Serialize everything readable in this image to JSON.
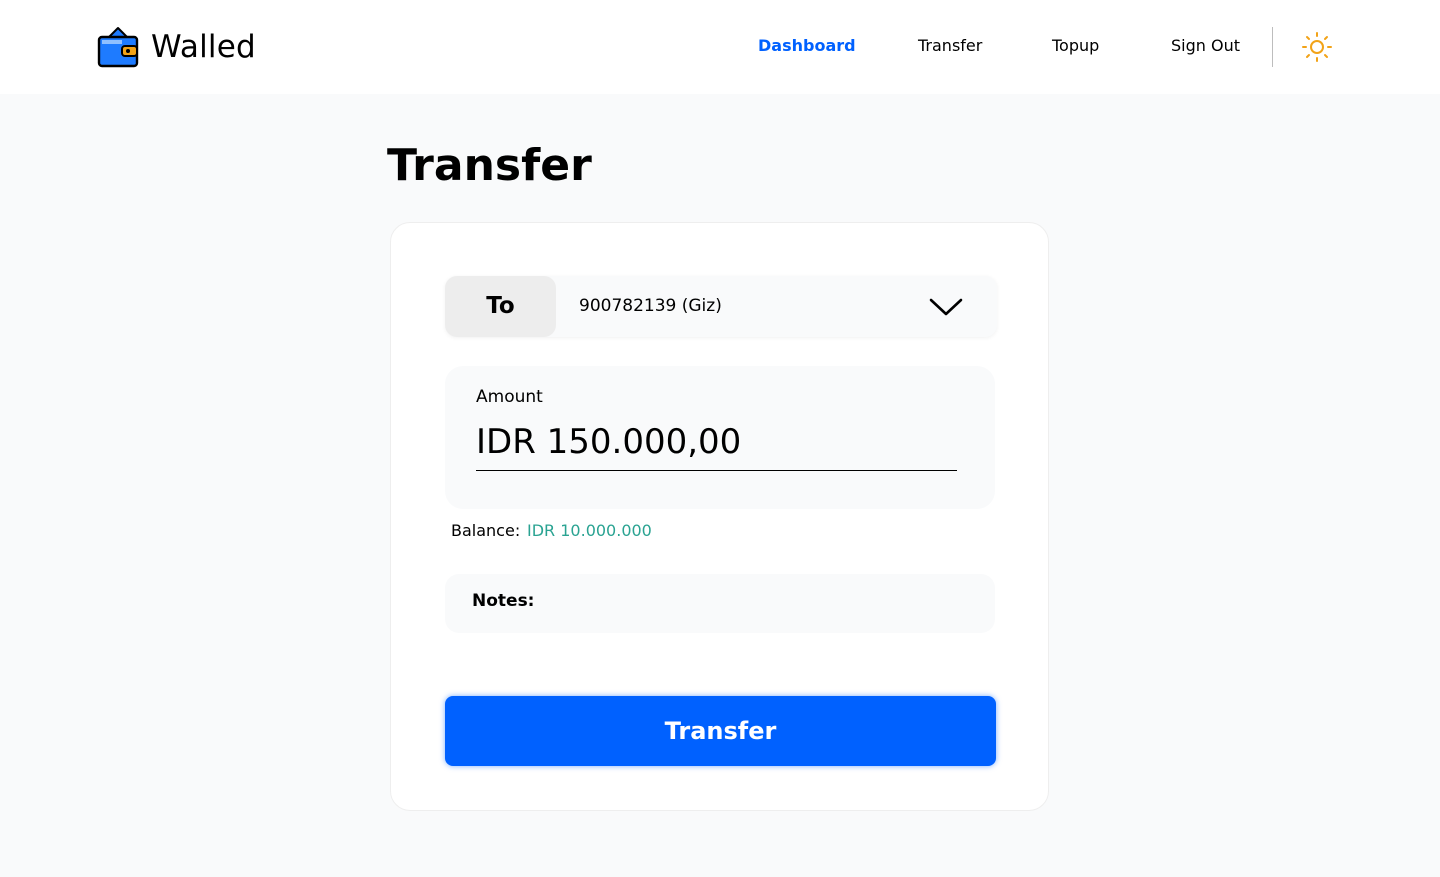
{
  "brand": {
    "name": "Walled",
    "logo_icon": "wallet-icon",
    "primary_color": "#0061ff",
    "accent_color": "#2aa392"
  },
  "nav": {
    "items": [
      {
        "label": "Dashboard",
        "active": true
      },
      {
        "label": "Transfer",
        "active": false
      },
      {
        "label": "Topup",
        "active": false
      },
      {
        "label": "Sign Out",
        "active": false
      }
    ],
    "theme_toggle_icon": "sun-icon"
  },
  "page": {
    "title": "Transfer"
  },
  "form": {
    "to_label": "To",
    "recipient_value": "900782139 (Giz)",
    "recipient_dropdown_icon": "chevron-down-icon",
    "amount_label": "Amount",
    "amount_value": "IDR 150.000,00",
    "balance_label": "Balance:",
    "balance_value": "IDR 10.000.000",
    "notes_label": "Notes:",
    "notes_value": "",
    "submit_label": "Transfer"
  }
}
